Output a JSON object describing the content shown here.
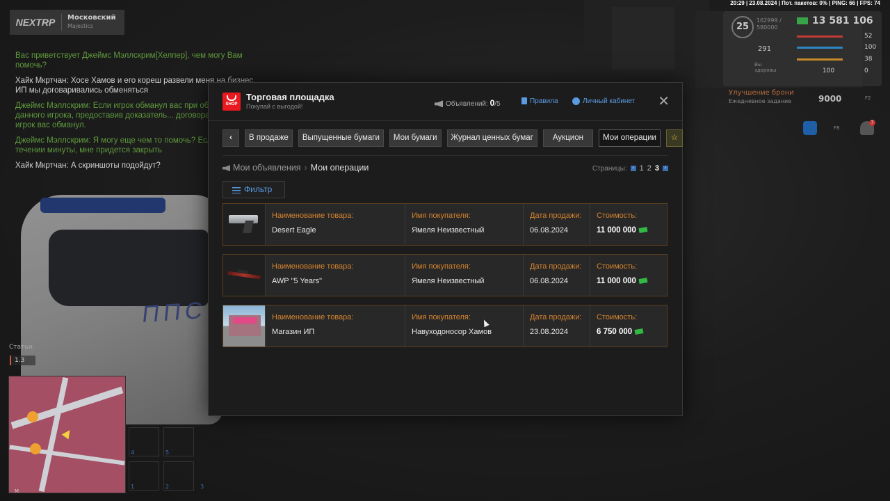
{
  "status_bar": "20:29 | 23.08.2024 | Пот. пакетов: 0% | PING: 66 | FPS: 74",
  "server": {
    "brand": "NEXTRP",
    "name": "Московский",
    "sub": "Majestics"
  },
  "chat": [
    {
      "color": "green",
      "text": "Вас приветствует Джеймс Мэллскрим[Хелпер], чем могу Вам помочь?"
    },
    {
      "color": "white",
      "text": "Хайк Мкртчан: Хосе Хамов и его кореш развели меня на бизнес ИП мы договаривались обменяться"
    },
    {
      "color": "green",
      "text": "Джеймс Мэллскрим: Если игрок обманул вас при обм... жалобу на данного игрока, предоставив доказатель... договора, и того что игрок вас обманул."
    },
    {
      "color": "green",
      "text": "Джеймс Мэллскрим: Я могу еще чем то помочь? Есл... поступит в течении минуты, мне придется закрыть"
    },
    {
      "color": "white",
      "text": "Хайк Мкртчан: А скриншоты подойдут?"
    }
  ],
  "hud": {
    "level": "25",
    "exp": "162999 / 580000",
    "money": "13 581 106",
    "armor_value": "291",
    "health_note": "Вы здоровы",
    "stats": [
      "52",
      "100",
      "38",
      "100",
      "0"
    ],
    "task_title": "Улучшение брони",
    "task_sub": "Ежедневное задание",
    "task_reward": "9000",
    "task_key": "F2",
    "menu_key": "F8",
    "notif_count": "7",
    "articles_label": "Статьи:",
    "articles_value": "1.3",
    "slot_numbers": [
      "4",
      "5",
      "1",
      "2",
      "3"
    ],
    "compass": "M"
  },
  "window": {
    "title": "Торговая площадка",
    "subtitle": "Покупай с выгодой!",
    "shop_badge": "SHOP",
    "ads_label": "Объявлений:",
    "ads_count": "0",
    "ads_max": "/5",
    "rules_link": "Правила",
    "cabinet_link": "Личный кабинет",
    "close": "✕"
  },
  "tabs": {
    "back": "‹",
    "items": [
      "В продаже",
      "Выпущенные бумаги",
      "Мои бумаги",
      "Журнал ценных бумаг",
      "Аукцион",
      "Мои операции"
    ],
    "active": "Мои операции",
    "star": "☆"
  },
  "breadcrumb": {
    "parent": "Мои объявления",
    "separator": "›",
    "current": "Мои операции"
  },
  "pagination": {
    "label": "Страницы:",
    "prev": "‹",
    "next": "›",
    "pages": [
      "1",
      "2",
      "3"
    ],
    "current": "3"
  },
  "filter_label": "Фильтр",
  "columns": {
    "item": "Наименование товара:",
    "buyer": "Имя покупателя:",
    "date": "Дата продажи:",
    "price": "Стоимость:"
  },
  "operations": [
    {
      "item": "Desert Eagle",
      "buyer": "Ямеля Неизвестный",
      "date": "06.08.2024",
      "price": "11 000 000"
    },
    {
      "item": "AWP \"5 Years\"",
      "buyer": "Ямеля Неизвестный",
      "date": "06.08.2024",
      "price": "11 000 000"
    },
    {
      "item": "Магазин ИП",
      "buyer": "Навуходоносор Хамов",
      "date": "23.08.2024",
      "price": "6 750 000"
    }
  ],
  "colors": {
    "accent_blue": "#5a9ae0",
    "label_orange": "#d5832f",
    "row_border": "#5b4020",
    "shop_red": "#e8191f"
  }
}
